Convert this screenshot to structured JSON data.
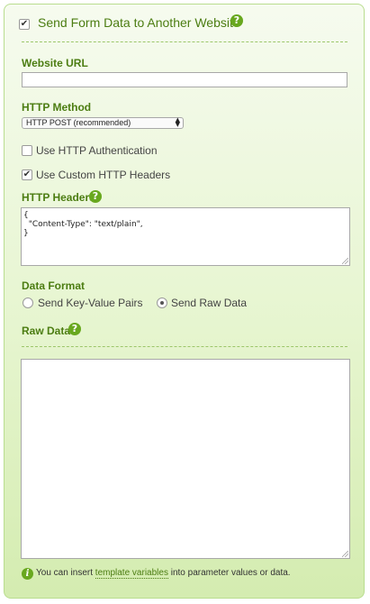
{
  "section": {
    "title": "Send Form Data to Another Website",
    "enabled": true
  },
  "website_url": {
    "label": "Website URL",
    "value": ""
  },
  "http_method": {
    "label": "HTTP Method",
    "selected": "HTTP POST (recommended)"
  },
  "options": {
    "http_auth": {
      "label": "Use HTTP Authentication",
      "checked": false
    },
    "custom_headers": {
      "label": "Use Custom HTTP Headers",
      "checked": true
    }
  },
  "http_headers": {
    "label": "HTTP Headers",
    "value": "{\n  \"Content-Type\": \"text/plain\",\n}"
  },
  "data_format": {
    "label": "Data Format",
    "key_value": "Send Key-Value Pairs",
    "raw": "Send Raw Data",
    "selected": "raw"
  },
  "raw_data": {
    "label": "Raw Data",
    "value": ""
  },
  "footer": {
    "before": "You can insert ",
    "link": "template variables",
    "after": " into parameter values or data."
  },
  "icons": {
    "help": "question-mark-icon",
    "info": "info-icon"
  },
  "colors": {
    "accent": "#68a81e",
    "label": "#4c7d12",
    "panel_top": "#f6fbef",
    "panel_bottom": "#d4ecb0"
  }
}
